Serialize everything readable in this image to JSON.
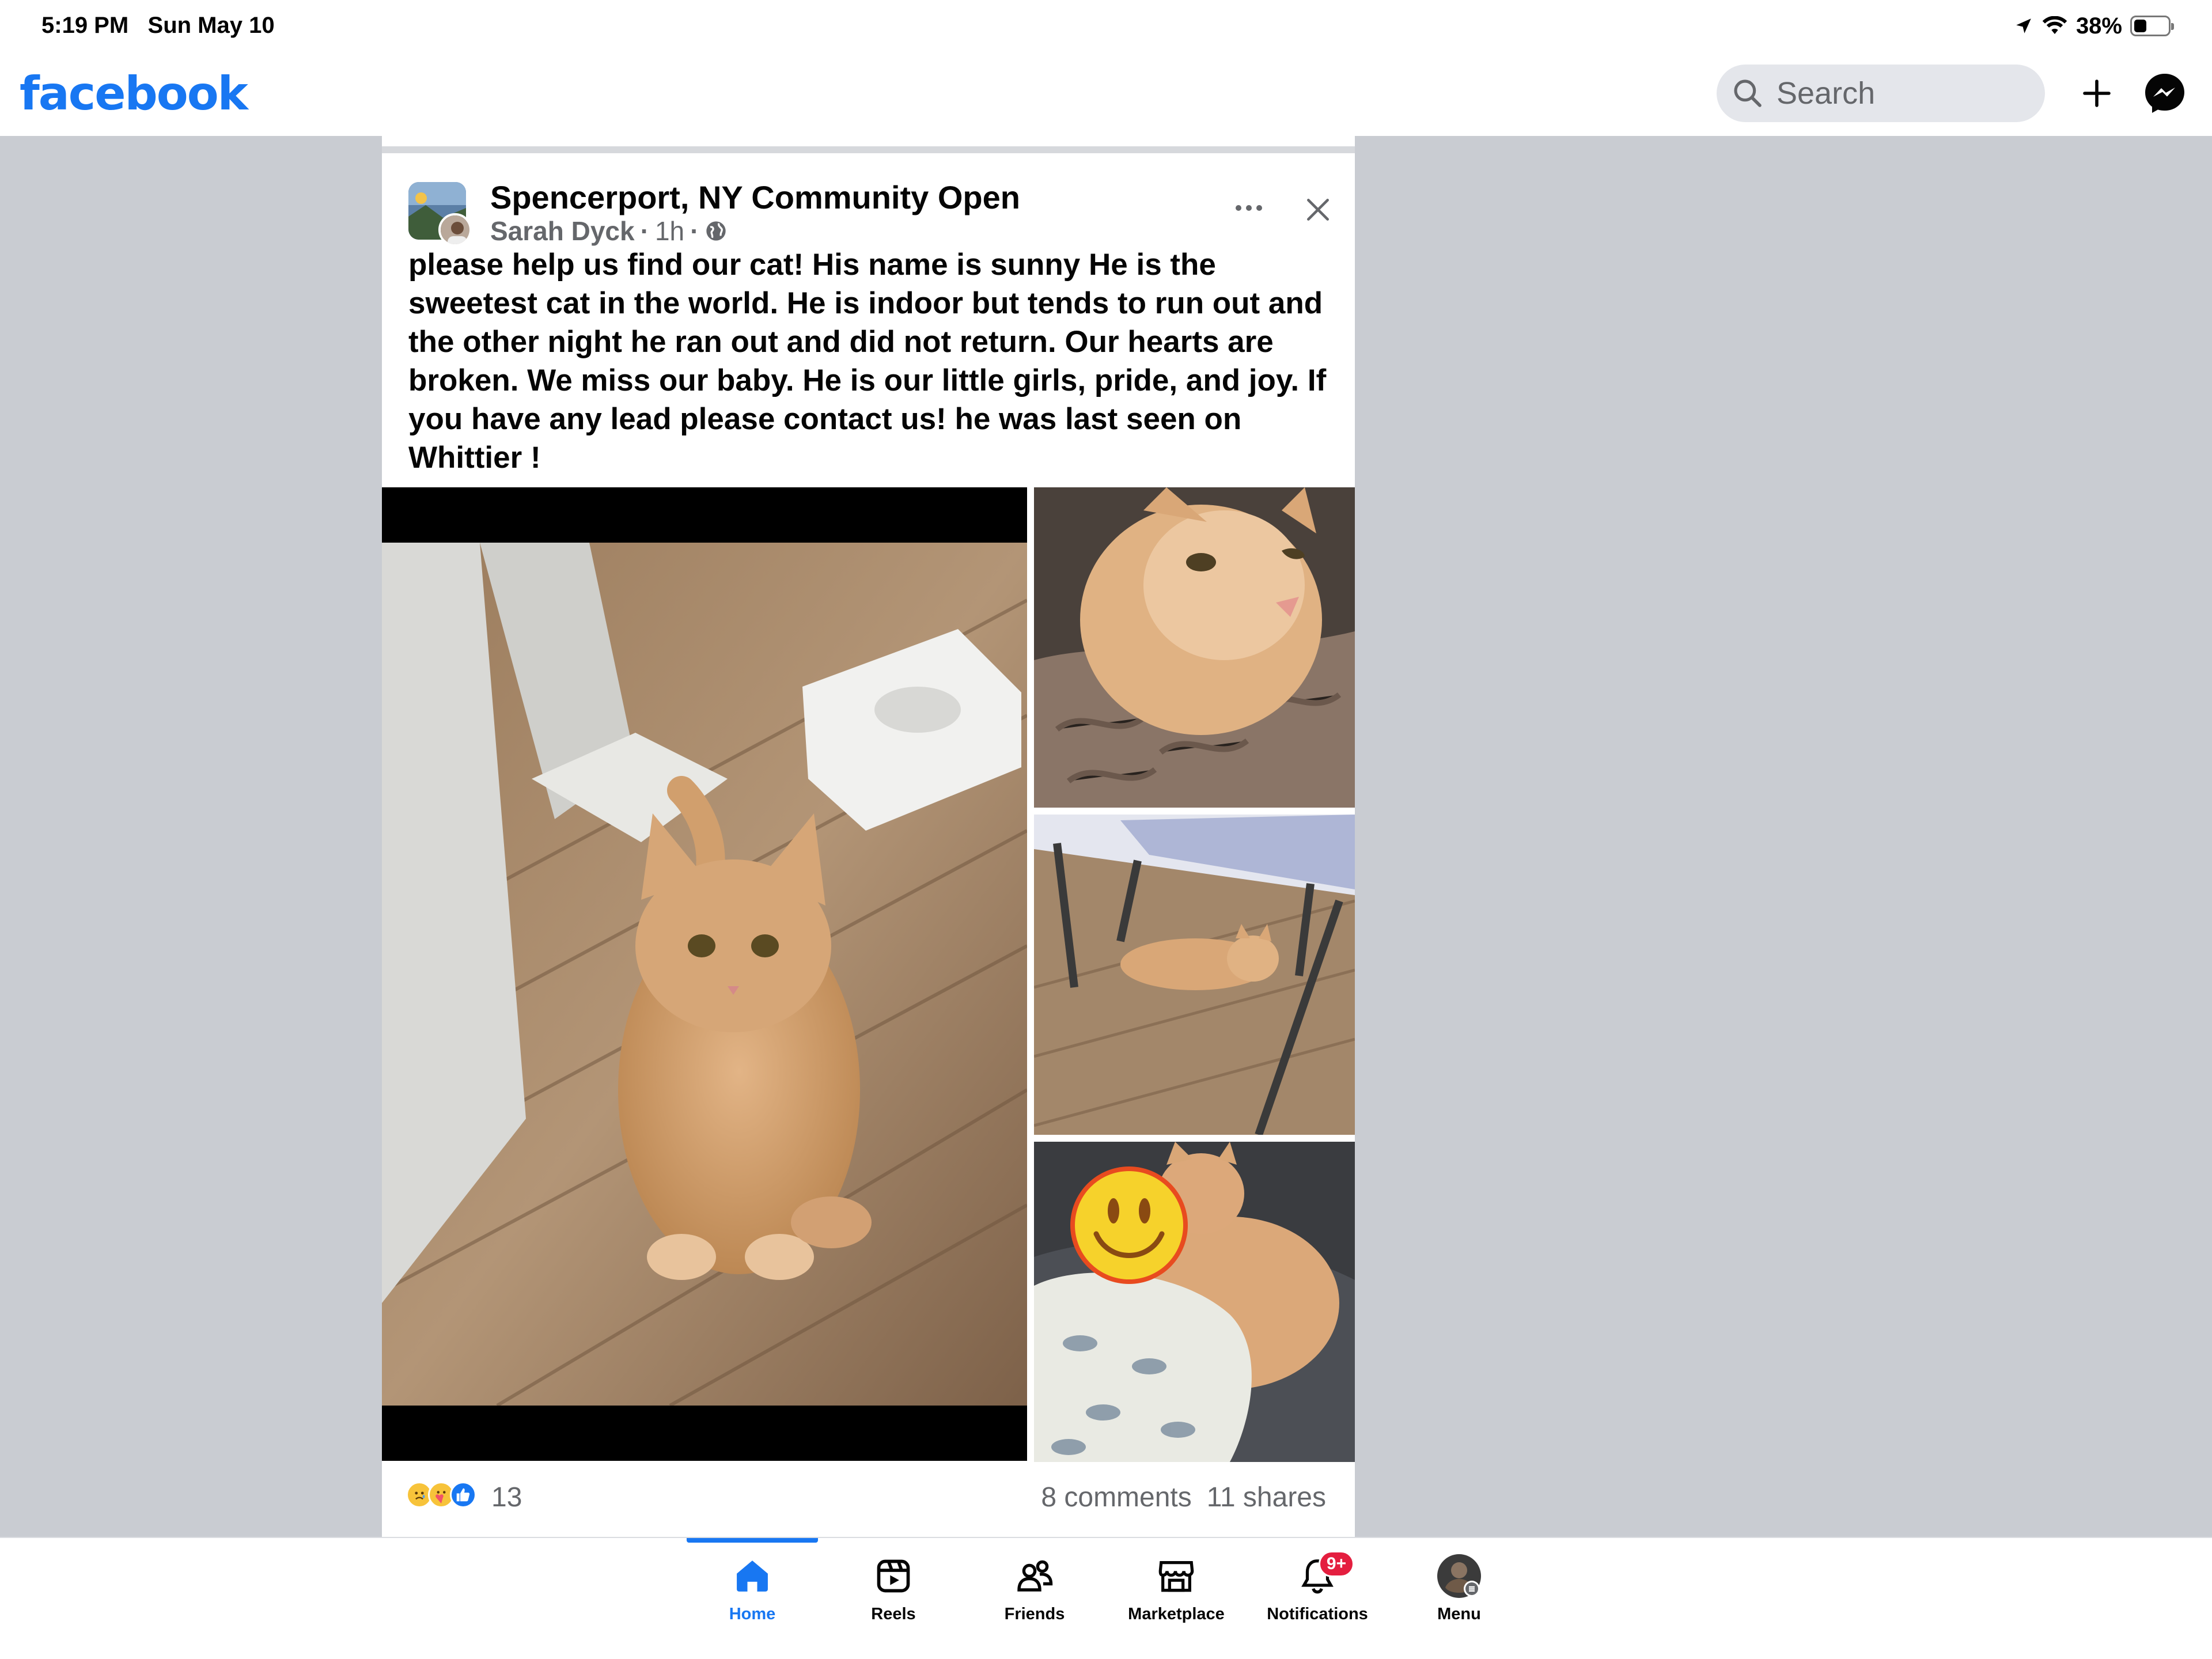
{
  "status_bar": {
    "time": "5:19 PM   Sun May 10",
    "battery": "38%",
    "battery_level": 0.38
  },
  "header": {
    "logo": "facebook",
    "search_placeholder": "Search",
    "plus_icon": "plus-icon",
    "messenger_icon": "messenger-icon",
    "brand_color": "#1877f2"
  },
  "post": {
    "group_name": "Spencerport, NY Community Open",
    "author": "Sarah Dyck",
    "time": "1h",
    "separator": "·",
    "text": "please help us find our cat! His name is sunny He is the sweetest cat in the world. He is indoor but tends to run out and the other night he ran out and did not return. Our hearts are broken. We miss our baby. He is our little girls, pride, and joy. If you have any lead please contact us! he was last seen on Whittier !",
    "reaction_count": "13",
    "comments": "8 comments",
    "shares": "11 shares",
    "reactions": [
      "sad",
      "care",
      "like"
    ]
  },
  "bottom_nav": {
    "items": [
      {
        "label": "Home",
        "icon": "home-icon",
        "active": true
      },
      {
        "label": "Reels",
        "icon": "reels-icon",
        "active": false
      },
      {
        "label": "Friends",
        "icon": "friends-icon",
        "active": false
      },
      {
        "label": "Marketplace",
        "icon": "marketplace-icon",
        "active": false
      },
      {
        "label": "Notifications",
        "icon": "bell-icon",
        "active": false,
        "badge": "9+"
      },
      {
        "label": "Menu",
        "icon": "profile-avatar",
        "active": false
      }
    ]
  }
}
